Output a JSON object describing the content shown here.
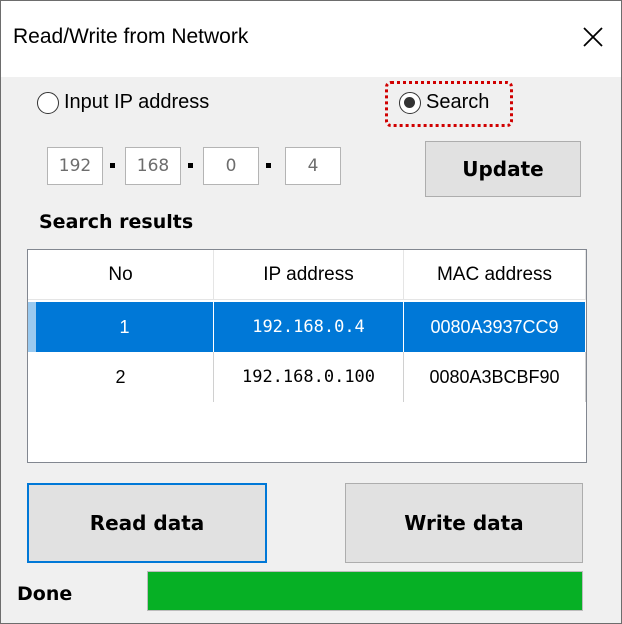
{
  "window": {
    "title": "Read/Write from Network",
    "close_icon": "close-icon"
  },
  "mode": {
    "input_ip_label": "Input IP address",
    "input_ip_selected": false,
    "search_label": "Search",
    "search_selected": true
  },
  "ip": {
    "octet1": "192",
    "octet2": "168",
    "octet3": "0",
    "octet4": "4"
  },
  "buttons": {
    "update": "Update",
    "read": "Read data",
    "write": "Write data"
  },
  "results": {
    "label": "Search results",
    "columns": [
      "No",
      "IP address",
      "MAC address"
    ],
    "rows": [
      {
        "no": "1",
        "ip": "192.168.0.4",
        "mac": "0080A3937CC9",
        "selected": true
      },
      {
        "no": "2",
        "ip": "192.168.0.100",
        "mac": "0080A3BCBF90",
        "selected": false
      }
    ]
  },
  "status": {
    "label": "Done",
    "progress": 1.0,
    "progress_color": "#06b025"
  },
  "colors": {
    "selection": "#0078d7",
    "highlight_box": "#d00000"
  }
}
